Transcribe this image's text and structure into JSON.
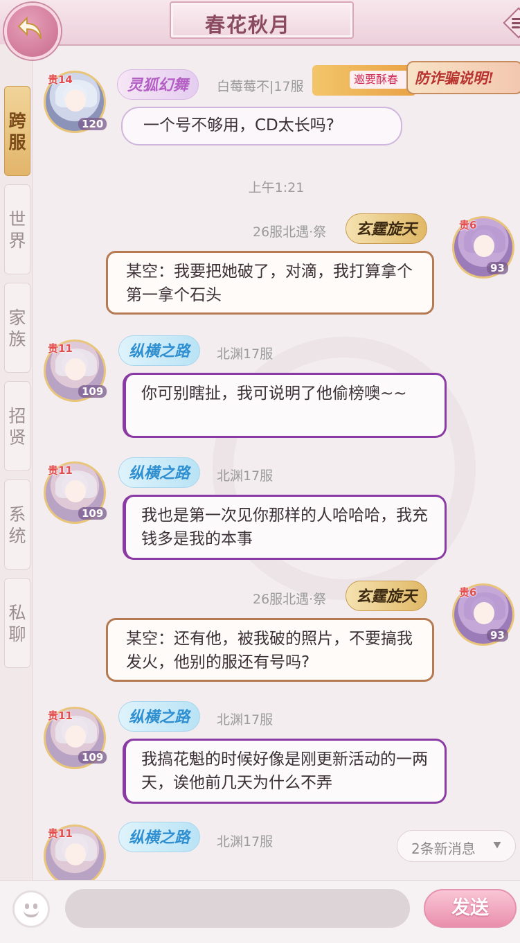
{
  "header": {
    "title": "春花秋月",
    "back_icon": "back-arrow-icon",
    "menu_icon": "menu-icon"
  },
  "sidebar": {
    "tabs": [
      {
        "label": "跨\n服",
        "active": true
      },
      {
        "label": "世\n界",
        "active": false
      },
      {
        "label": "家\n族",
        "active": false
      },
      {
        "label": "招\n贤",
        "active": false
      },
      {
        "label": "系\n统",
        "active": false
      },
      {
        "label": "私\n聊",
        "active": false
      }
    ]
  },
  "banner": {
    "anti_fraud": "防诈骗说明!",
    "promo_text": "邀要酥春"
  },
  "messages": [
    {
      "vip": "贵14",
      "level": "120",
      "badge": "灵狐幻舞",
      "server": "白莓莓不|17服",
      "text": "一个号不够用，CD太长吗?"
    },
    {
      "time": "上午1:21"
    },
    {
      "vip": "贵6",
      "level": "93",
      "badge": "玄霆旋天",
      "server": "26服北遇·祭",
      "text": "某空：我要把她破了，对滴，我打算拿个第一拿个石头"
    },
    {
      "vip": "贵11",
      "level": "109",
      "badge": "纵横之路",
      "server": "北渊17服",
      "text": "你可别瞎扯，我可说明了他偷榜噢~~"
    },
    {
      "vip": "贵11",
      "level": "109",
      "badge": "纵横之路",
      "server": "北渊17服",
      "text": "我也是第一次见你那样的人哈哈哈，我充钱多是我的本事"
    },
    {
      "vip": "贵6",
      "level": "93",
      "badge": "玄霆旋天",
      "server": "26服北遇·祭",
      "text": "某空：还有他，被我破的照片，不要搞我发火，他别的服还有号吗?"
    },
    {
      "vip": "贵11",
      "level": "109",
      "badge": "纵横之路",
      "server": "北渊17服",
      "text": "我搞花魁的时候好像是刚更新活动的一两天，诶他前几天为什么不弄"
    },
    {
      "vip": "贵11",
      "badge": "纵横之路",
      "server": "北渊17服"
    }
  ],
  "new_messages": {
    "label": "2条新消息",
    "icon": "double-chevron-down-icon"
  },
  "input": {
    "placeholder": "",
    "emoji_icon": "emoji-icon",
    "send_label": "发送"
  },
  "colors": {
    "accent_pink": "#ea8fad",
    "left_bubble_border": "#8a3aa3",
    "right_bubble_border": "#b57a52",
    "vip_red": "#e24e4e"
  }
}
